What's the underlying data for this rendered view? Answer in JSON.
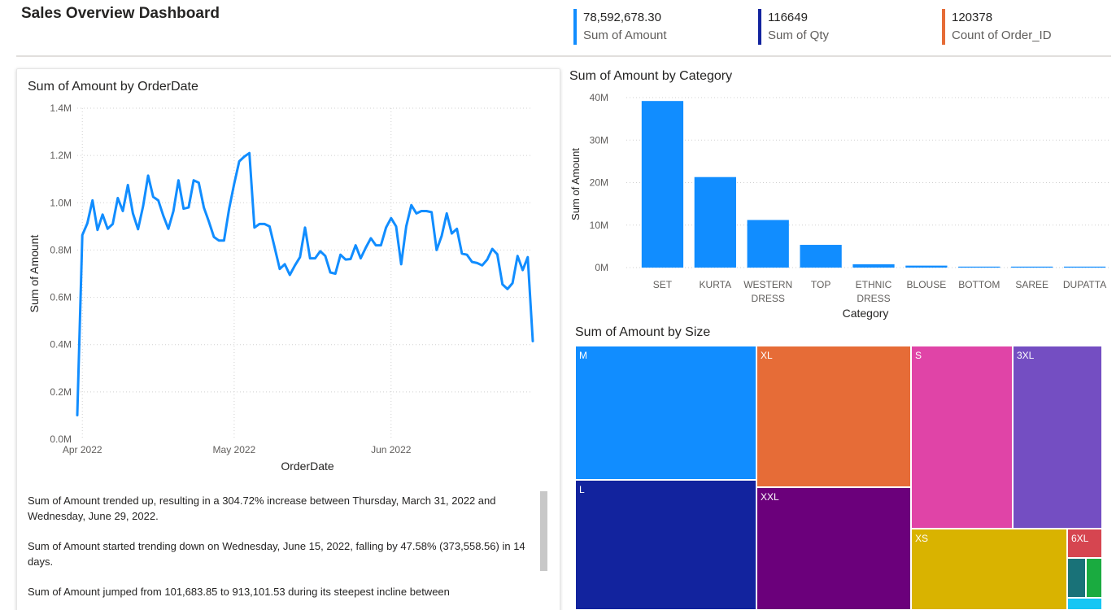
{
  "header": {
    "title": "Sales Overview Dashboard",
    "kpis": [
      {
        "value": "78,592,678.30",
        "label": "Sum of Amount",
        "color": "#118dff"
      },
      {
        "value": "116649",
        "label": "Sum of Qty",
        "color": "#12239e"
      },
      {
        "value": "120378",
        "label": "Count of Order_ID",
        "color": "#e66c37"
      }
    ]
  },
  "line_visual": {
    "title": "Sum of Amount by OrderDate",
    "xlabel": "OrderDate",
    "ylabel": "Sum of Amount",
    "y_ticks": [
      "0.0M",
      "0.2M",
      "0.4M",
      "0.6M",
      "0.8M",
      "1.0M",
      "1.2M",
      "1.4M"
    ],
    "x_ticks": [
      "Apr 2022",
      "May 2022",
      "Jun 2022"
    ]
  },
  "bar_visual": {
    "title": "Sum of Amount by Category",
    "xlabel": "Category",
    "ylabel": "Sum of Amount",
    "y_ticks": [
      "0M",
      "10M",
      "20M",
      "30M",
      "40M"
    ],
    "category_labels": [
      [
        "SET"
      ],
      [
        "KURTA"
      ],
      [
        "WESTERN",
        "DRESS"
      ],
      [
        "TOP"
      ],
      [
        "ETHNIC",
        "DRESS"
      ],
      [
        "BLOUSE"
      ],
      [
        "BOTTOM"
      ],
      [
        "SAREE"
      ],
      [
        "DUPATTA"
      ]
    ]
  },
  "treemap_visual": {
    "title": "Sum of Amount by Size",
    "tiles": [
      {
        "label": "M",
        "color": "#118dff"
      },
      {
        "label": "L",
        "color": "#12239e"
      },
      {
        "label": "XL",
        "color": "#e66c37"
      },
      {
        "label": "XXL",
        "color": "#6b007b"
      },
      {
        "label": "S",
        "color": "#e044a7"
      },
      {
        "label": "XS",
        "color": "#d9b300"
      },
      {
        "label": "3XL",
        "color": "#744ec2"
      },
      {
        "label": "6XL",
        "color": "#d64550"
      },
      {
        "label": "",
        "color": "#197278"
      },
      {
        "label": "",
        "color": "#1aab40"
      },
      {
        "label": "",
        "color": "#15c6f4"
      }
    ]
  },
  "narrative": [
    "Sum of Amount trended up, resulting in a 304.72% increase between Thursday, March 31, 2022 and Wednesday, June 29, 2022.",
    "Sum of Amount started trending down on Wednesday, June 15, 2022, falling by 47.58% (373,558.56) in 14 days.",
    "Sum of Amount jumped from 101,683.85 to 913,101.53 during its steepest incline between"
  ],
  "chart_data": [
    {
      "type": "line",
      "title": "Sum of Amount by OrderDate",
      "xlabel": "OrderDate",
      "ylabel": "Sum of Amount",
      "x_start": "2022-03-31",
      "x_end": "2022-06-29",
      "ylim": [
        0,
        1400000
      ],
      "grid": true,
      "series": [
        {
          "color": "#118dff",
          "values": [
            101684,
            863000,
            913102,
            1010000,
            885000,
            950000,
            890000,
            910000,
            1020000,
            965000,
            1075000,
            955000,
            888000,
            985000,
            1115000,
            1025000,
            1010000,
            945000,
            890000,
            965000,
            1095000,
            975000,
            980000,
            1095000,
            1085000,
            980000,
            920000,
            855000,
            840000,
            840000,
            975000,
            1080000,
            1175000,
            1195000,
            1210000,
            895000,
            910000,
            910000,
            900000,
            810000,
            720000,
            740000,
            695000,
            735000,
            770000,
            895000,
            765000,
            765000,
            795000,
            775000,
            705000,
            700000,
            780000,
            760000,
            762000,
            820000,
            765000,
            810000,
            850000,
            820000,
            820000,
            895000,
            935000,
            900000,
            740000,
            900000,
            990000,
            955000,
            965000,
            965000,
            960000,
            800000,
            860000,
            955000,
            870000,
            890000,
            785000,
            780000,
            750000,
            745000,
            735000,
            760000,
            805000,
            782000,
            655000,
            635000,
            660000,
            775000,
            715000,
            770000,
            415000
          ]
        }
      ]
    },
    {
      "type": "bar",
      "title": "Sum of Amount by Category",
      "xlabel": "Category",
      "ylabel": "Sum of Amount",
      "categories": [
        "SET",
        "KURTA",
        "WESTERN DRESS",
        "TOP",
        "ETHNIC DRESS",
        "BLOUSE",
        "BOTTOM",
        "SAREE",
        "DUPATTA"
      ],
      "values": [
        39200000,
        21300000,
        11200000,
        5350000,
        790000,
        460000,
        150000,
        120000,
        1000
      ],
      "ylim": [
        0,
        40000000
      ],
      "color": "#118dff"
    }
  ]
}
